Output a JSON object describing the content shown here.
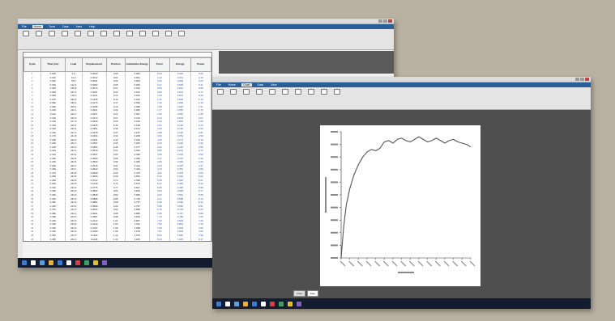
{
  "back_window": {
    "menu_tabs": [
      "File",
      "Home",
      "Tools",
      "Data",
      "View",
      "Help"
    ],
    "active_tab": "Home",
    "ribbon_buttons": [
      "",
      "",
      "",
      "",
      "",
      "",
      "",
      "",
      "",
      "",
      "",
      "",
      ""
    ],
    "sheet_title": "",
    "columns": [
      "Cycle",
      "Time (ms)",
      "Load",
      "Displacement",
      "Position",
      "Cumulative Energy",
      "Force",
      "Energy",
      "Power"
    ],
    "rows": [
      [
        "1",
        "0.000",
        "0.0",
        "0.0000",
        "0.00",
        "0.000",
        "0.00",
        "0.000",
        "0.00"
      ],
      [
        "2",
        "0.010",
        "41.2",
        "0.0012",
        "0.01",
        "0.001",
        "0.12",
        "0.001",
        "0.10"
      ],
      [
        "3",
        "0.020",
        "78.5",
        "0.0031",
        "0.03",
        "0.004",
        "0.29",
        "0.003",
        "0.24"
      ],
      [
        "4",
        "0.030",
        "112.4",
        "0.0052",
        "0.05",
        "0.009",
        "0.47",
        "0.006",
        "0.41"
      ],
      [
        "5",
        "0.040",
        "139.8",
        "0.0074",
        "0.07",
        "0.015",
        "0.66",
        "0.010",
        "0.58"
      ],
      [
        "6",
        "0.050",
        "161.3",
        "0.0097",
        "0.09",
        "0.023",
        "0.84",
        "0.015",
        "0.77"
      ],
      [
        "7",
        "0.060",
        "178.0",
        "0.0121",
        "0.12",
        "0.032",
        "1.03",
        "0.021",
        "0.96"
      ],
      [
        "8",
        "0.070",
        "190.6",
        "0.0145",
        "0.14",
        "0.043",
        "1.21",
        "0.028",
        "1.14"
      ],
      [
        "9",
        "0.080",
        "199.2",
        "0.0170",
        "0.17",
        "0.055",
        "1.40",
        "0.036",
        "1.33"
      ],
      [
        "10",
        "0.090",
        "205.4",
        "0.0195",
        "0.19",
        "0.068",
        "1.58",
        "0.045",
        "1.51"
      ],
      [
        "11",
        "0.100",
        "210.1",
        "0.0221",
        "0.22",
        "0.082",
        "1.77",
        "0.055",
        "1.70"
      ],
      [
        "12",
        "0.110",
        "213.7",
        "0.0247",
        "0.24",
        "0.097",
        "1.95",
        "0.066",
        "1.88"
      ],
      [
        "13",
        "0.120",
        "216.0",
        "0.0273",
        "0.27",
        "0.113",
        "2.14",
        "0.078",
        "2.07"
      ],
      [
        "14",
        "0.130",
        "217.9",
        "0.0299",
        "0.29",
        "0.130",
        "2.32",
        "0.091",
        "2.25"
      ],
      [
        "15",
        "0.140",
        "219.3",
        "0.0325",
        "0.32",
        "0.148",
        "2.51",
        "0.105",
        "2.44"
      ],
      [
        "16",
        "0.150",
        "220.4",
        "0.0351",
        "0.35",
        "0.167",
        "2.69",
        "0.120",
        "2.62"
      ],
      [
        "17",
        "0.160",
        "221.2",
        "0.0378",
        "0.37",
        "0.187",
        "2.88",
        "0.136",
        "2.81"
      ],
      [
        "18",
        "0.170",
        "221.8",
        "0.0404",
        "0.40",
        "0.208",
        "3.06",
        "0.153",
        "2.99"
      ],
      [
        "19",
        "0.180",
        "222.3",
        "0.0431",
        "0.43",
        "0.230",
        "3.25",
        "0.171",
        "3.18"
      ],
      [
        "20",
        "0.190",
        "222.7",
        "0.0457",
        "0.45",
        "0.253",
        "3.43",
        "0.190",
        "3.36"
      ],
      [
        "21",
        "0.200",
        "223.0",
        "0.0484",
        "0.48",
        "0.277",
        "3.62",
        "0.210",
        "3.55"
      ],
      [
        "22",
        "0.210",
        "223.2",
        "0.0510",
        "0.51",
        "0.302",
        "3.80",
        "0.231",
        "3.73"
      ],
      [
        "23",
        "0.220",
        "223.4",
        "0.0537",
        "0.53",
        "0.328",
        "3.99",
        "0.253",
        "3.92"
      ],
      [
        "24",
        "0.230",
        "223.5",
        "0.0563",
        "0.56",
        "0.355",
        "4.17",
        "0.276",
        "4.10"
      ],
      [
        "25",
        "0.240",
        "223.6",
        "0.0590",
        "0.59",
        "0.383",
        "4.36",
        "0.300",
        "4.29"
      ],
      [
        "26",
        "0.250",
        "223.7",
        "0.0616",
        "0.61",
        "0.412",
        "4.54",
        "0.325",
        "4.47"
      ],
      [
        "27",
        "0.260",
        "223.7",
        "0.0643",
        "0.64",
        "0.442",
        "4.73",
        "0.351",
        "4.66"
      ],
      [
        "28",
        "0.270",
        "223.8",
        "0.0669",
        "0.66",
        "0.473",
        "4.91",
        "0.378",
        "4.84"
      ],
      [
        "29",
        "0.280",
        "223.8",
        "0.0696",
        "0.69",
        "0.505",
        "5.10",
        "0.406",
        "5.03"
      ],
      [
        "30",
        "0.290",
        "223.8",
        "0.0722",
        "0.72",
        "0.538",
        "5.28",
        "0.435",
        "5.21"
      ],
      [
        "31",
        "0.300",
        "223.9",
        "0.0749",
        "0.74",
        "0.572",
        "5.47",
        "0.465",
        "5.40"
      ],
      [
        "32",
        "0.310",
        "223.9",
        "0.0775",
        "0.77",
        "0.607",
        "5.65",
        "0.496",
        "5.58"
      ],
      [
        "33",
        "0.320",
        "223.9",
        "0.0802",
        "0.80",
        "0.643",
        "5.84",
        "0.528",
        "5.77"
      ],
      [
        "34",
        "0.330",
        "223.9",
        "0.0828",
        "0.82",
        "0.680",
        "6.02",
        "0.561",
        "5.95"
      ],
      [
        "35",
        "0.340",
        "223.9",
        "0.0855",
        "0.85",
        "0.718",
        "6.21",
        "0.595",
        "6.14"
      ],
      [
        "36",
        "0.350",
        "223.9",
        "0.0881",
        "0.88",
        "0.757",
        "6.39",
        "0.630",
        "6.32"
      ],
      [
        "37",
        "0.360",
        "224.0",
        "0.0908",
        "0.90",
        "0.797",
        "6.58",
        "0.666",
        "6.51"
      ],
      [
        "38",
        "0.370",
        "224.0",
        "0.0934",
        "0.93",
        "0.838",
        "6.76",
        "0.703",
        "6.69"
      ],
      [
        "39",
        "0.380",
        "224.0",
        "0.0961",
        "0.96",
        "0.880",
        "6.95",
        "0.741",
        "6.88"
      ],
      [
        "40",
        "0.390",
        "224.0",
        "0.0987",
        "0.98",
        "0.923",
        "7.13",
        "0.780",
        "7.06"
      ],
      [
        "41",
        "0.400",
        "224.0",
        "0.1014",
        "1.01",
        "0.967",
        "7.32",
        "0.820",
        "7.25"
      ],
      [
        "42",
        "0.410",
        "224.0",
        "0.1040",
        "1.04",
        "1.012",
        "7.50",
        "0.861",
        "7.43"
      ],
      [
        "43",
        "0.420",
        "224.0",
        "0.1067",
        "1.06",
        "1.058",
        "7.69",
        "0.903",
        "7.62"
      ],
      [
        "44",
        "0.430",
        "224.0",
        "0.1093",
        "1.09",
        "1.105",
        "7.87",
        "0.946",
        "7.80"
      ],
      [
        "45",
        "0.440",
        "224.0",
        "0.1120",
        "1.12",
        "1.153",
        "8.06",
        "0.990",
        "7.99"
      ],
      [
        "46",
        "0.450",
        "224.0",
        "0.1146",
        "1.14",
        "1.202",
        "8.24",
        "1.035",
        "8.17"
      ]
    ]
  },
  "front_window": {
    "menu_tabs": [
      "File",
      "Home",
      "Chart",
      "Data",
      "View"
    ],
    "active_tab": "Chart",
    "ribbon_buttons": [
      "",
      "",
      "",
      "",
      "",
      "",
      "",
      "",
      "",
      ""
    ],
    "chart_heading": "",
    "bottom_tabs": [
      "Chart",
      "Data"
    ]
  },
  "chart_data": {
    "type": "line",
    "title": "",
    "xlabel": "",
    "ylabel": "",
    "series": [
      {
        "x": [
          0,
          0.3,
          0.6,
          1,
          1.5,
          2,
          2.5,
          3,
          3.5,
          4,
          4.5,
          5,
          5.5,
          6,
          6.5,
          7,
          7.5,
          8,
          8.5,
          9,
          9.5,
          10,
          10.5,
          11,
          11.5,
          12,
          12.5,
          13,
          13.5,
          14,
          14.5,
          15
        ],
        "y": [
          0,
          0.25,
          0.42,
          0.55,
          0.66,
          0.74,
          0.8,
          0.84,
          0.86,
          0.85,
          0.87,
          0.92,
          0.93,
          0.91,
          0.94,
          0.95,
          0.93,
          0.92,
          0.94,
          0.96,
          0.94,
          0.92,
          0.93,
          0.95,
          0.93,
          0.91,
          0.93,
          0.94,
          0.92,
          0.91,
          0.9,
          0.88
        ]
      }
    ],
    "xlim": [
      0,
      15
    ],
    "ylim": [
      0,
      1
    ],
    "line_color": "#555555"
  },
  "colors": {
    "desktop": "#b9b1a1",
    "menubar": "#2b5f9a",
    "chart_window_bg": "#4f4f4f",
    "taskbar": "#141c2f"
  }
}
